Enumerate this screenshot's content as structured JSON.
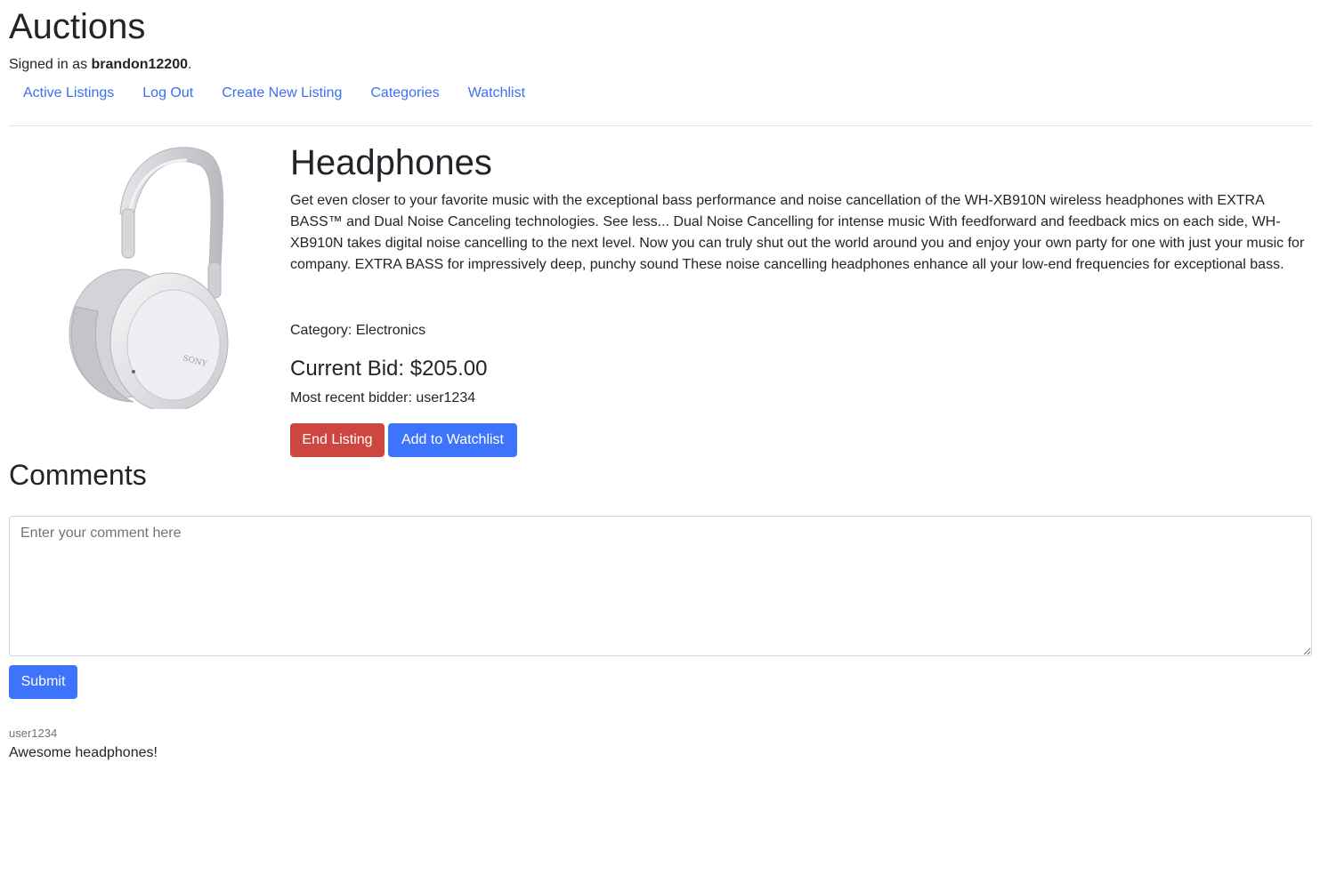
{
  "app": {
    "title": "Auctions",
    "signed_in_prefix": "Signed in as",
    "username": "brandon12200",
    "signed_in_suffix": "."
  },
  "nav": {
    "items": [
      {
        "label": "Active Listings"
      },
      {
        "label": "Log Out"
      },
      {
        "label": "Create New Listing"
      },
      {
        "label": "Categories"
      },
      {
        "label": "Watchlist"
      }
    ]
  },
  "listing": {
    "image_icon": "headphones-image",
    "title": "Headphones",
    "description": "Get even closer to your favorite music with the exceptional bass performance and noise cancellation of the WH-XB910N wireless headphones with EXTRA BASS™ and Dual Noise Canceling technologies. See less... Dual Noise Cancelling for intense music With feedforward and feedback mics on each side, WH-XB910N takes digital noise cancelling to the next level. Now you can truly shut out the world around you and enjoy your own party for one with just your music for company. EXTRA BASS for impressively deep, punchy sound These noise cancelling headphones enhance all your low-end frequencies for exceptional bass.",
    "category_label": "Category: Electronics",
    "current_bid_label": "Current Bid: $205.00",
    "recent_bidder_label": "Most recent bidder: user1234",
    "brand_text": "SONY",
    "end_button": "End Listing",
    "watchlist_button": "Add to Watchlist"
  },
  "comments": {
    "title": "Comments",
    "placeholder": "Enter your comment here",
    "submit_button": "Submit",
    "items": [
      {
        "user": "user1234",
        "text": "Awesome headphones!"
      }
    ]
  },
  "colors": {
    "link": "#3b6ff5",
    "primary": "#3d74fb",
    "danger": "#cd4740"
  }
}
